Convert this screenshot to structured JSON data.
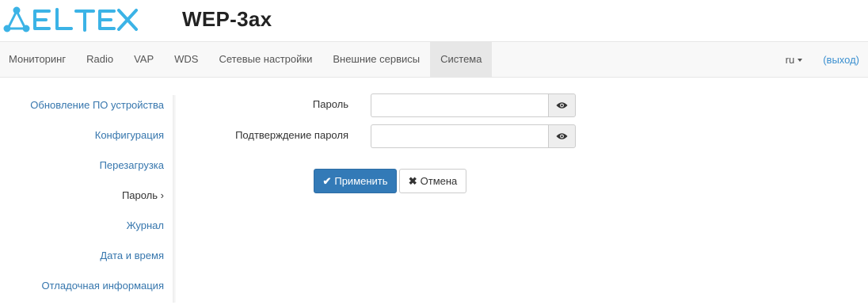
{
  "header": {
    "logo_text": "ELTEX",
    "product": "WEP-3ax"
  },
  "nav": {
    "items": [
      {
        "label": "Мониторинг"
      },
      {
        "label": "Radio"
      },
      {
        "label": "VAP"
      },
      {
        "label": "WDS"
      },
      {
        "label": "Сетевые настройки"
      },
      {
        "label": "Внешние сервисы"
      },
      {
        "label": "Система",
        "active": true
      }
    ],
    "lang": "ru",
    "logout": "(выход)"
  },
  "sidebar": {
    "items": [
      {
        "label": "Обновление ПО устройства"
      },
      {
        "label": "Конфигурация"
      },
      {
        "label": "Перезагрузка"
      },
      {
        "label": "Пароль ›",
        "active": true
      },
      {
        "label": "Журнал"
      },
      {
        "label": "Дата и время"
      },
      {
        "label": "Отладочная информация"
      }
    ]
  },
  "form": {
    "password_label": "Пароль",
    "password_value": "",
    "confirm_label": "Подтверждение пароля",
    "confirm_value": "",
    "apply_label": "Применить",
    "cancel_label": "Отмена"
  },
  "colors": {
    "accent": "#3bb3e6",
    "primary_button": "#337ab7",
    "link": "#3676ad"
  }
}
